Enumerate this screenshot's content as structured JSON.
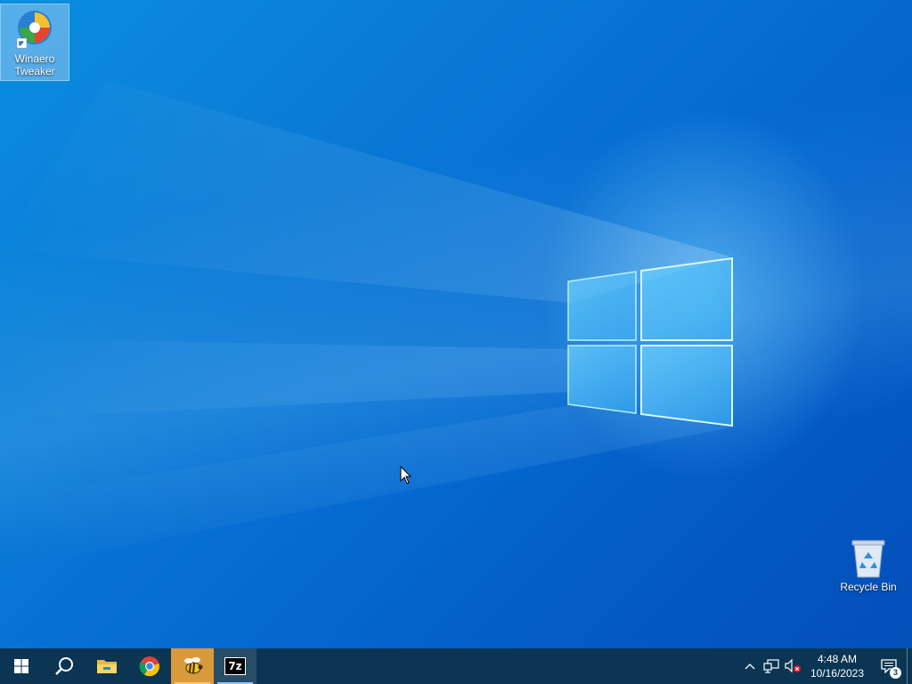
{
  "desktop": {
    "icons": [
      {
        "label_line1": "Winaero",
        "label_line2": "Tweaker",
        "icon": "winaero-tweaker-icon",
        "shortcut": true,
        "selected": true
      },
      {
        "label_line1": "Recycle Bin",
        "icon": "recycle-bin-icon"
      }
    ]
  },
  "taskbar": {
    "buttons": [
      {
        "name": "start",
        "icon": "windows-start-icon"
      },
      {
        "name": "search",
        "icon": "search-icon"
      },
      {
        "name": "file-explorer",
        "icon": "folder-icon"
      },
      {
        "name": "chrome",
        "icon": "chrome-icon"
      },
      {
        "name": "bee-app",
        "icon": "bee-app-icon",
        "highlighted": true
      },
      {
        "name": "7zip",
        "icon": "7zip-icon",
        "label": "7z",
        "active": true
      }
    ],
    "tray": {
      "time": "4:48 AM",
      "date": "10/16/2023",
      "notification_count": "3",
      "icons": [
        "chevron-up-icon",
        "network-icon",
        "volume-muted-icon"
      ]
    }
  },
  "colors": {
    "taskbar_bg": "#0b3553",
    "desktop_accent": "#0a7ad6",
    "highlight": "#d99a3c"
  }
}
